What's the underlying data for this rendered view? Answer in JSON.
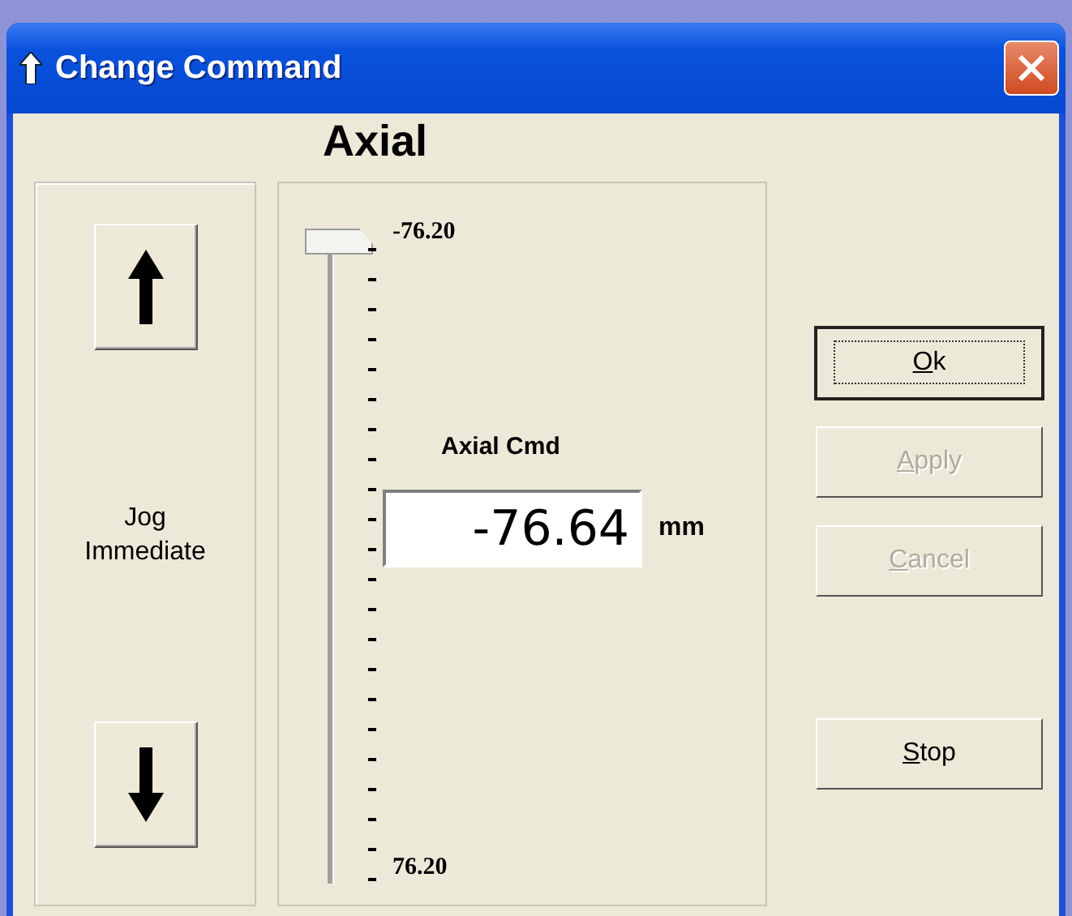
{
  "window": {
    "title": "Change Command"
  },
  "heading": "Axial",
  "jog": {
    "label": "Jog Immediate"
  },
  "slider": {
    "min_label": "-76.20",
    "max_label": "76.20"
  },
  "command": {
    "label": "Axial Cmd",
    "value": "-76.64",
    "unit": "mm"
  },
  "buttons": [
    {
      "label": "Ok",
      "disabled": false,
      "default": true,
      "mnemonic": true
    },
    {
      "label": "Apply",
      "disabled": true,
      "default": false,
      "mnemonic": true
    },
    {
      "label": "Cancel",
      "disabled": true,
      "default": false,
      "mnemonic": true
    },
    {
      "label": "Stop",
      "disabled": false,
      "default": false,
      "mnemonic": true
    }
  ]
}
